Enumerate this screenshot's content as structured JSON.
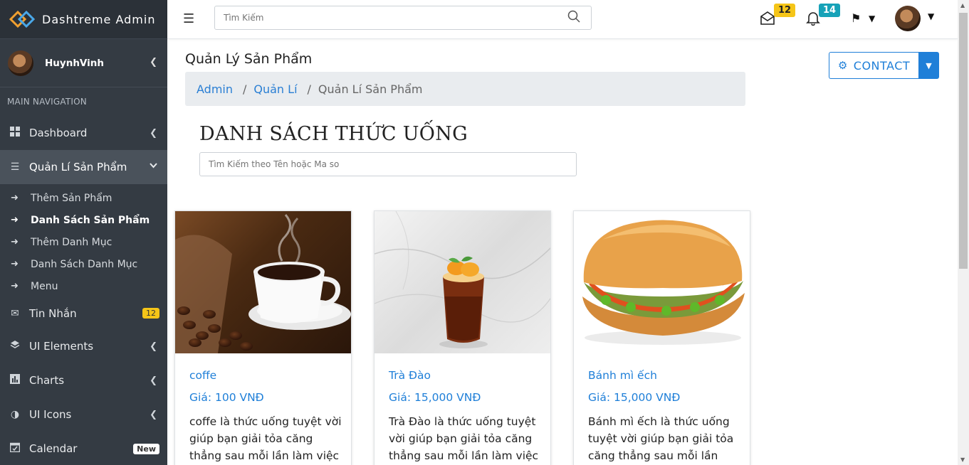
{
  "brand": {
    "title": "Dashtreme Admin"
  },
  "user": {
    "name": "HuynhVinh"
  },
  "sidebar": {
    "section_header": "MAIN NAVIGATION",
    "items": [
      {
        "label": "Dashboard",
        "icon": "dashboard-icon"
      },
      {
        "label": "Quản Lí Sản Phẩm",
        "icon": "list-icon"
      },
      {
        "label": "Tin Nhắn",
        "icon": "mail-icon",
        "badge": "12"
      },
      {
        "label": "UI Elements",
        "icon": "layers-icon"
      },
      {
        "label": "Charts",
        "icon": "chart-icon"
      },
      {
        "label": "UI Icons",
        "icon": "contrast-icon"
      },
      {
        "label": "Calendar",
        "icon": "calendar-icon",
        "badge": "New"
      }
    ],
    "sub_items": [
      {
        "label": "Thêm Sản Phẩm"
      },
      {
        "label": "Danh Sách Sản Phẩm"
      },
      {
        "label": "Thêm Danh Mục"
      },
      {
        "label": "Danh Sách Danh Mục"
      },
      {
        "label": "Menu"
      }
    ]
  },
  "topbar": {
    "search_placeholder": "Tìm Kiếm",
    "mail_badge": "12",
    "bell_badge": "14"
  },
  "page": {
    "title": "Quản Lý Sản Phẩm",
    "breadcrumb": [
      "Admin",
      "Quản Lí",
      "Quản Lí Sản Phẩm"
    ],
    "contact_label": "CONTACT",
    "list_heading": "DANH SÁCH THỨC UỐNG",
    "list_search_placeholder": "Tìm Kiếm theo Tên hoặc Ma so"
  },
  "products": [
    {
      "name": "coffe",
      "price": "Giá: 100 VNĐ",
      "desc": "coffe là thức uống tuyệt vời giúp bạn giải tỏa căng thẳng sau mỗi lần làm việc"
    },
    {
      "name": "Trà Đào",
      "price": "Giá: 15,000 VNĐ",
      "desc": "Trà Đào là thức uống tuyệt vời giúp bạn giải tỏa căng thẳng sau mỗi lần làm việc"
    },
    {
      "name": "Bánh mì ếch",
      "price": "Giá: 15,000 VNĐ",
      "desc": "Bánh mì ếch là thức uống tuyệt vời giúp bạn giải tỏa căng thẳng sau mỗi lần"
    }
  ],
  "colors": {
    "sidebar": "#343b43",
    "accent": "#1f7fd8",
    "badge_yellow": "#f5c518",
    "badge_teal": "#17a2b8"
  }
}
